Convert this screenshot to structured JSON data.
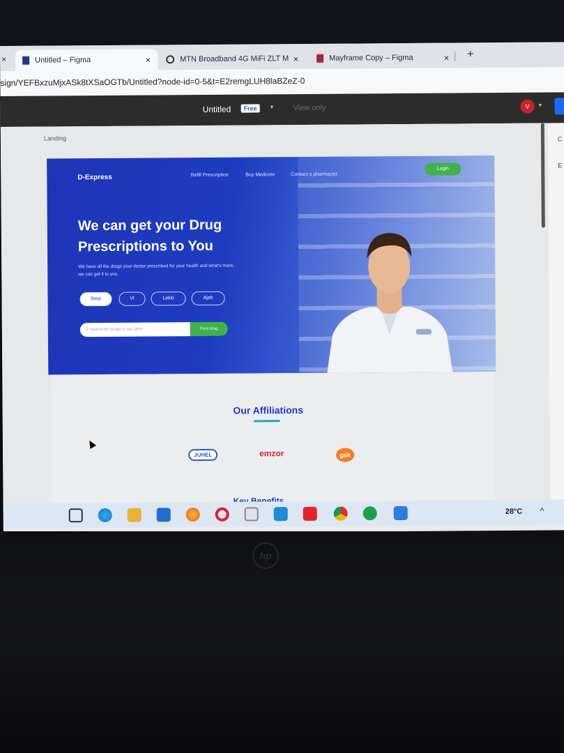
{
  "browser": {
    "tabs": [
      {
        "title": "Untitled – Figma",
        "active": true
      },
      {
        "title": "MTN Broadband 4G MiFi ZLT M",
        "active": false
      },
      {
        "title": "Mayframe Copy – Figma",
        "active": false
      }
    ],
    "address": "sign/YEFBxzuMjxASk8tXSaOGTb/Untitled?node-id=0-5&t=E2remgLUH8laBZeZ-0",
    "close_glyph": "×",
    "new_tab_glyph": "+"
  },
  "figma": {
    "file_name": "Untitled",
    "plan_badge": "Free",
    "mode": "View only",
    "avatar_initial": "V",
    "frame_label": "Landing",
    "right_panel": [
      "C",
      "E"
    ]
  },
  "landing": {
    "brand": "D-Express",
    "nav": [
      "Refill Prescription",
      "Buy Medicine",
      "Contact a pharmacist"
    ],
    "login": "Login",
    "headline": "We can get your Drug Prescriptions to You",
    "subtext": "We have all the drugs your doctor prescribed for your health and what's more, we can get it to you.",
    "locations": [
      "Ikeja",
      "VI",
      "Lekki",
      "Ajah"
    ],
    "search_placeholder": "Search for drugs in our store",
    "search_button": "Find drug",
    "affiliations_title": "Our Affiliations",
    "affiliations": [
      "JUHEL",
      "emzor",
      "gsk"
    ],
    "next_section": "Key Benefits"
  },
  "taskbar": {
    "weather": "28°C",
    "accent": "#1b6cf2"
  }
}
